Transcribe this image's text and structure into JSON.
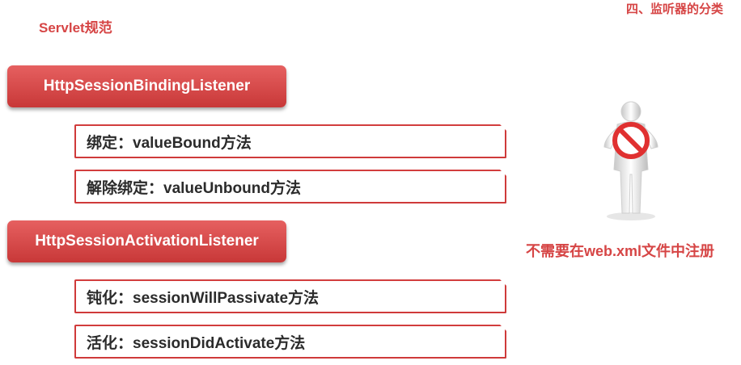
{
  "header": {
    "left_title": "Servlet规范",
    "right_title": "四、监听器的分类"
  },
  "listeners": [
    {
      "name": "HttpSessionBindingListener",
      "methods": [
        "绑定：valueBound方法",
        "解除绑定：valueUnbound方法"
      ]
    },
    {
      "name": "HttpSessionActivationListener",
      "methods": [
        "钝化：sessionWillPassivate方法",
        "活化：sessionDidActivate方法"
      ]
    }
  ],
  "note": "不需要在web.xml文件中注册",
  "colors": {
    "accent": "#d64545",
    "pill": "#d24646"
  },
  "icons": [
    "no-sign-person-icon"
  ]
}
